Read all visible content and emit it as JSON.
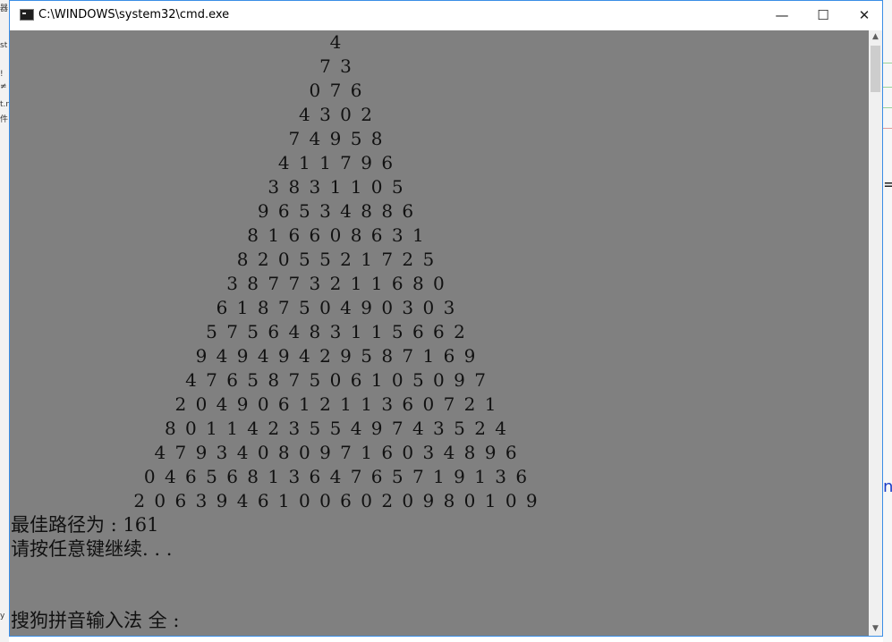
{
  "window": {
    "title": "C:\\WINDOWS\\system32\\cmd.exe",
    "minimize_glyph": "—",
    "maximize_glyph": "☐",
    "close_glyph": "✕"
  },
  "console": {
    "triangle_rows": [
      "4",
      "7 3",
      "0 7 6",
      "4 3 0 2",
      "7 4 9 5 8",
      "4 1 1 7 9 6",
      "3 8 3 1 1 0 5",
      "9 6 5 3 4 8 8 6",
      "8 1 6 6 0 8 6 3 1",
      "8 2 0 5 5 2 1 7 2 5",
      "3 8 7 7 3 2 1 1 6 8 0",
      "6 1 8 7 5 0 4 9 0 3 0 3",
      "5 7 5 6 4 8 3 1 1 5 6 6 2",
      "9 4 9 4 9 4 2 9 5 8 7 1 6 9",
      "4 7 6 5 8 7 5 0 6 1 0 5 0 9 7",
      "2 0 4 9 0 6 1 2 1 1 3 6 0 7 2 1",
      "8 0 1 1 4 2 3 5 5 4 9 7 4 3 5 2 4",
      "4 7 9 3 4 0 8 0 9 7 1 6 0 3 4 8 9 6",
      "0 4 6 5 6 8 1 3 6 4 7 6 5 7 1 9 1 3 6",
      "2 0 6 3 9 4 6 1 0 0 6 0 2 0 9 8 0 1 0 9"
    ],
    "result_line": "最佳路径为 : 161",
    "continue_prompt": "请按任意键继续. . .",
    "ime_status": "搜狗拼音输入法 全 :"
  },
  "scrollbar": {
    "up_glyph": "▲",
    "down_glyph": "▼"
  },
  "background_window_fragments": [
    "器",
    "st",
    "!",
    "≠",
    "t.n",
    "件",
    "y"
  ],
  "background_right_glyphs": [
    "=",
    "n"
  ],
  "colors": {
    "console_bg": "#808080",
    "console_text": "#111111",
    "titlebar_bg": "#ffffff",
    "window_border": "#3a8ee6"
  }
}
